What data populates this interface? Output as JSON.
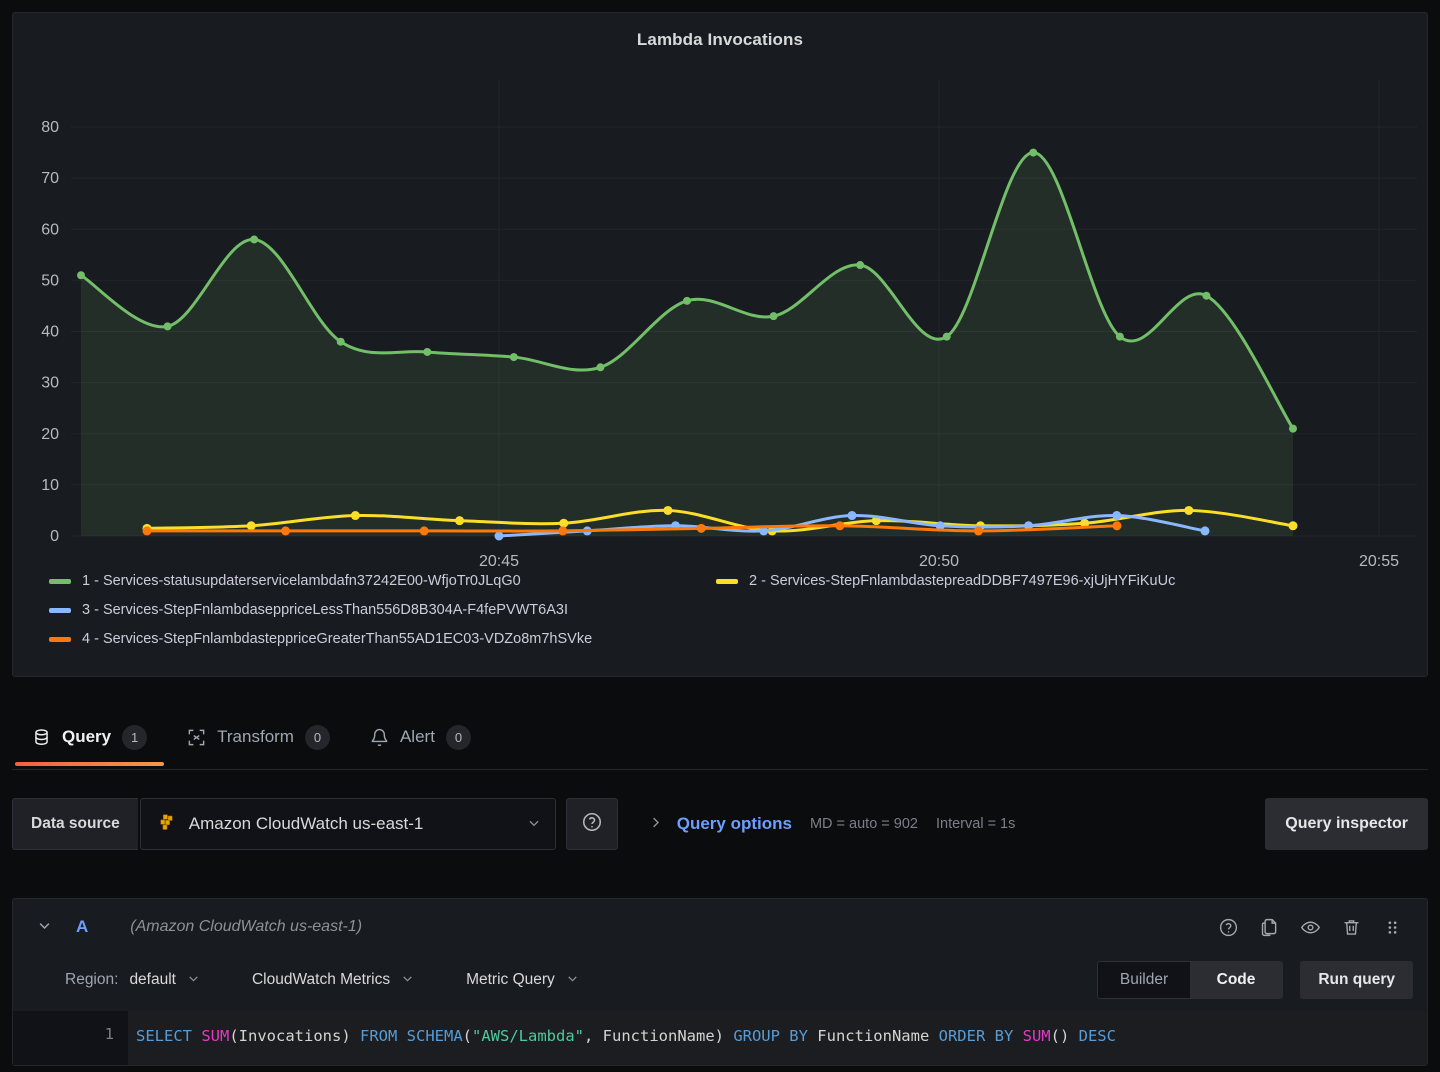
{
  "panel": {
    "title": "Lambda Invocations"
  },
  "chart_data": {
    "type": "line",
    "title": "Lambda Invocations",
    "xlabel": "",
    "ylabel": "",
    "ylim": [
      0,
      80
    ],
    "yticks": [
      0,
      10,
      20,
      30,
      40,
      50,
      60,
      70,
      80
    ],
    "xticks": [
      "20:45",
      "20:50",
      "20:55"
    ],
    "grid": true,
    "legend_position": "bottom",
    "x": [
      0,
      1,
      2,
      3,
      4,
      5,
      6,
      7,
      8,
      9,
      10,
      11,
      12,
      13,
      14,
      15,
      16
    ],
    "series": [
      {
        "name": "1 - Services-statusupdaterservicelambdafn37242E00-WfjoTr0JLqG0",
        "color": "#73bf69",
        "fill": true,
        "values": [
          51,
          41,
          58,
          38,
          36,
          35,
          33,
          46,
          43,
          53,
          39,
          75,
          39,
          47,
          21
        ]
      },
      {
        "name": "2 - Services-StepFnlambdastepreadDDBF7497E96-xjUjHYFiKuUc",
        "color": "#fade2a",
        "fill": false,
        "values": [
          1.5,
          2,
          4,
          3,
          2.5,
          5,
          1,
          3,
          2,
          2.5,
          5,
          2
        ]
      },
      {
        "name": "3 - Services-StepFnlambdaseppriceLessThan556D8B304A-F4fePVWT6A3I",
        "color": "#8ab8ff",
        "fill": false,
        "values": [
          0,
          1,
          2,
          1,
          4,
          2,
          2,
          4,
          1
        ]
      },
      {
        "name": "4 - Services-StepFnlambdasteppriceGreaterThan55AD1EC03-VDZo8m7hSVke",
        "color": "#ff780a",
        "fill": false,
        "values": [
          1,
          1,
          1,
          1,
          1.5,
          2,
          1,
          2
        ]
      }
    ]
  },
  "legend": [
    {
      "label": "1 - Services-statusupdaterservicelambdafn37242E00-WfjoTr0JLqG0",
      "color": "#73bf69"
    },
    {
      "label": "2 - Services-StepFnlambdastepreadDDBF7497E96-xjUjHYFiKuUc",
      "color": "#fade2a"
    },
    {
      "label": "3 - Services-StepFnlambdaseppriceLessThan556D8B304A-F4fePVWT6A3I",
      "color": "#8ab8ff"
    },
    {
      "label": "4 - Services-StepFnlambdasteppriceGreaterThan55AD1EC03-VDZo8m7hSVke",
      "color": "#ff780a"
    }
  ],
  "tabs": [
    {
      "label": "Query",
      "count": "1",
      "icon": "database-icon",
      "active": true
    },
    {
      "label": "Transform",
      "count": "0",
      "icon": "transform-icon",
      "active": false
    },
    {
      "label": "Alert",
      "count": "0",
      "icon": "bell-icon",
      "active": false
    }
  ],
  "datasource_row": {
    "label": "Data source",
    "selected": "Amazon CloudWatch us-east-1",
    "help_icon": "question-circle-icon",
    "query_options_label": "Query options",
    "md_text": "MD = auto = 902",
    "interval_text": "Interval = 1s",
    "query_inspector_label": "Query inspector"
  },
  "query": {
    "ref_id": "A",
    "datasource_note": "(Amazon CloudWatch us-east-1)",
    "region_label": "Region:",
    "region_value": "default",
    "namespace_value": "CloudWatch Metrics",
    "query_mode_value": "Metric Query",
    "toggle": {
      "builder": "Builder",
      "code": "Code",
      "selected": "Code"
    },
    "run_label": "Run query",
    "line_number": "1",
    "sql_tokens": [
      {
        "t": "SELECT",
        "c": "kw"
      },
      {
        "t": " ",
        "c": "pl"
      },
      {
        "t": "SUM",
        "c": "fn"
      },
      {
        "t": "(Invocations) ",
        "c": "pl"
      },
      {
        "t": "FROM",
        "c": "kw"
      },
      {
        "t": " ",
        "c": "pl"
      },
      {
        "t": "SCHEMA",
        "c": "kw"
      },
      {
        "t": "(",
        "c": "pl"
      },
      {
        "t": "\"AWS/Lambda\"",
        "c": "str"
      },
      {
        "t": ", FunctionName) ",
        "c": "pl"
      },
      {
        "t": "GROUP BY",
        "c": "kw"
      },
      {
        "t": " FunctionName ",
        "c": "pl"
      },
      {
        "t": "ORDER BY",
        "c": "kw"
      },
      {
        "t": " ",
        "c": "pl"
      },
      {
        "t": "SUM",
        "c": "fn"
      },
      {
        "t": "() ",
        "c": "pl"
      },
      {
        "t": "DESC",
        "c": "kw"
      }
    ]
  },
  "colors": {
    "accent_orange": "#f55f3e",
    "link_blue": "#6e9fff",
    "panel_bg": "#181b1f",
    "page_bg": "#0b0c0e"
  }
}
